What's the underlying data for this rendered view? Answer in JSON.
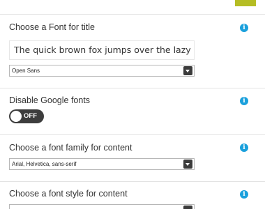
{
  "colors": {
    "accent": "#b5bd24",
    "info": "#1aa0dc",
    "toggle_bg": "#3d3d3d"
  },
  "sections": {
    "title_font": {
      "label": "Choose a Font for title",
      "preview_text": "The quick brown fox jumps over the lazy dog",
      "selected": "Open Sans",
      "info_icon": "info-icon"
    },
    "google_fonts": {
      "label": "Disable Google fonts",
      "toggle_state": "OFF",
      "info_icon": "info-icon"
    },
    "content_family": {
      "label": "Choose a font family for content",
      "selected": "Arial, Helvetica, sans-serif",
      "info_icon": "info-icon"
    },
    "content_style": {
      "label": "Choose a font style for content",
      "info_icon": "info-icon"
    }
  },
  "icons": {
    "info_glyph": "i"
  }
}
